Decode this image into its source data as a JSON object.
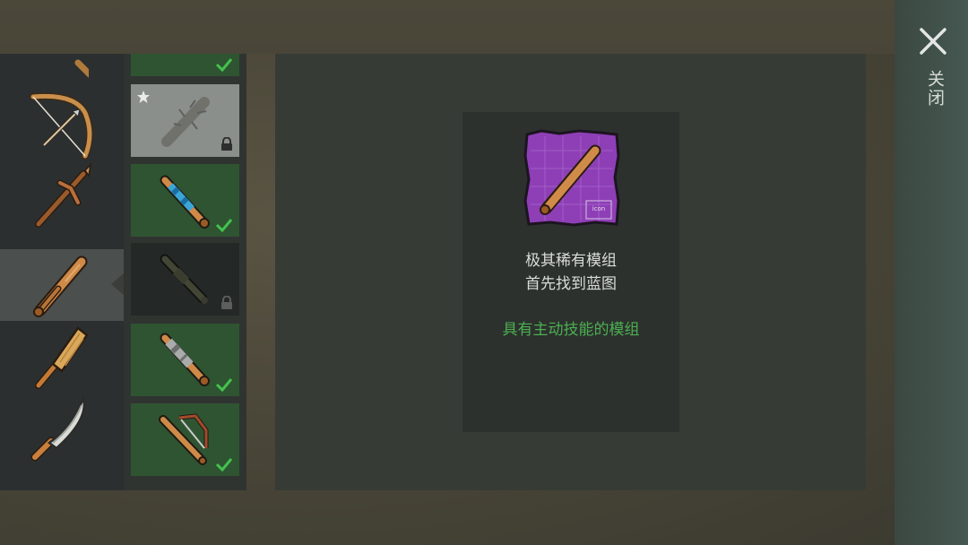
{
  "close": {
    "label": "关闭"
  },
  "weapons": [
    {
      "name": "bow-icon"
    },
    {
      "name": "pickaxe-icon"
    },
    {
      "name": "baseball-bat-icon",
      "selected": true
    },
    {
      "name": "wooden-paddle-icon"
    },
    {
      "name": "machete-icon"
    }
  ],
  "mods": [
    {
      "name": "spiked-bat-mod-icon",
      "state": "locked",
      "starred": true
    },
    {
      "name": "taped-bat-mod-icon",
      "state": "unlocked"
    },
    {
      "name": "pipe-bat-mod-icon",
      "state": "locked"
    },
    {
      "name": "metal-sleeve-bat-mod-icon",
      "state": "unlocked"
    },
    {
      "name": "saw-bat-mod-icon",
      "state": "unlocked"
    }
  ],
  "detail": {
    "blueprint_icon": "baseball-bat-blueprint-icon",
    "blueprint_text": "icon",
    "rarity": "极其稀有模组",
    "hint": "首先找到蓝图",
    "skill": "具有主动技能的模组"
  },
  "colors": {
    "skill_text": "#4caf50",
    "unlocked_slot": "#2f5432",
    "check": "#43c24d",
    "blueprint": "#8e3fb6"
  }
}
